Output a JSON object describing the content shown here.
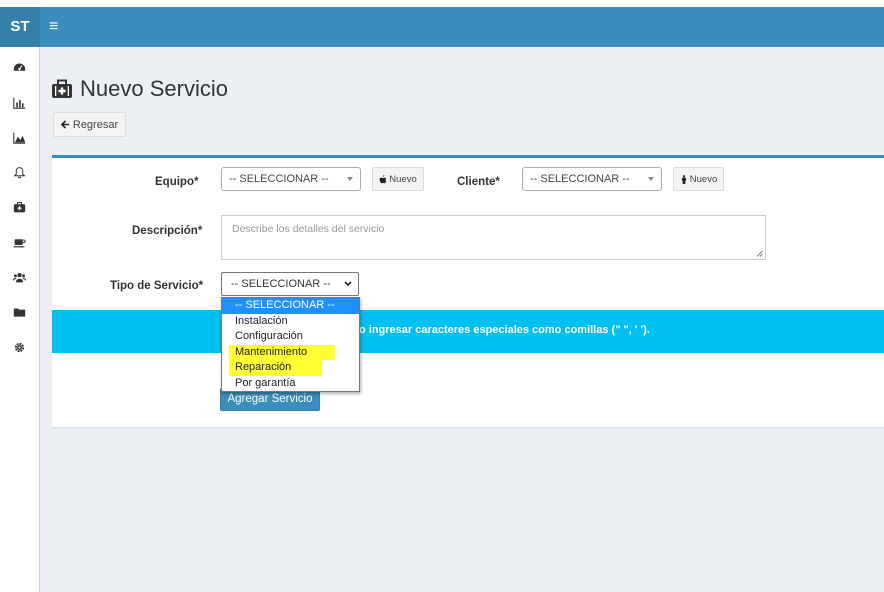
{
  "app": {
    "logo": "ST",
    "menu_glyph": "≡"
  },
  "sidebar": {
    "items": [
      {
        "icon": "dashboard-icon"
      },
      {
        "icon": "bar-chart-icon"
      },
      {
        "icon": "area-chart-icon"
      },
      {
        "icon": "bell-icon"
      },
      {
        "icon": "medkit-icon"
      },
      {
        "icon": "coffee-icon"
      },
      {
        "icon": "users-icon"
      },
      {
        "icon": "folder-icon"
      },
      {
        "icon": "gear-icon"
      }
    ]
  },
  "page": {
    "title": "Nuevo Servicio",
    "back_label": "Regresar"
  },
  "form": {
    "equipo_label": "Equipo*",
    "equipo_value": "-- SELECCIONAR --",
    "equipo_new_label": "Nuevo",
    "cliente_label": "Cliente*",
    "cliente_value": "-- SELECCIONAR --",
    "cliente_new_label": "Nuevo",
    "descripcion_label": "Descripción*",
    "descripcion_placeholder": "Describe los detalles del servicio",
    "tipo_label": "Tipo de Servicio*",
    "tipo_value": "-- SELECCIONAR --",
    "notice": "o ingresar caracteres especiales como comillas (\" \", ' ').",
    "submit_label": "Agregar Servicio"
  },
  "dropdown": {
    "options": [
      {
        "label": "-- SELECCIONAR --",
        "selected": true,
        "highlight": false
      },
      {
        "label": "Instalación",
        "selected": false,
        "highlight": false
      },
      {
        "label": "Configuración",
        "selected": false,
        "highlight": false
      },
      {
        "label": "Mantenimiento",
        "selected": false,
        "highlight": true
      },
      {
        "label": "Reparación",
        "selected": false,
        "highlight": true
      },
      {
        "label": "Por garantía",
        "selected": false,
        "highlight": false
      }
    ]
  },
  "colors": {
    "header": "#3c8dbc",
    "callout": "#00c0ef",
    "primary": "#3c8dbc",
    "selected_option": "#1e90ff",
    "highlight": "#ffff33"
  }
}
